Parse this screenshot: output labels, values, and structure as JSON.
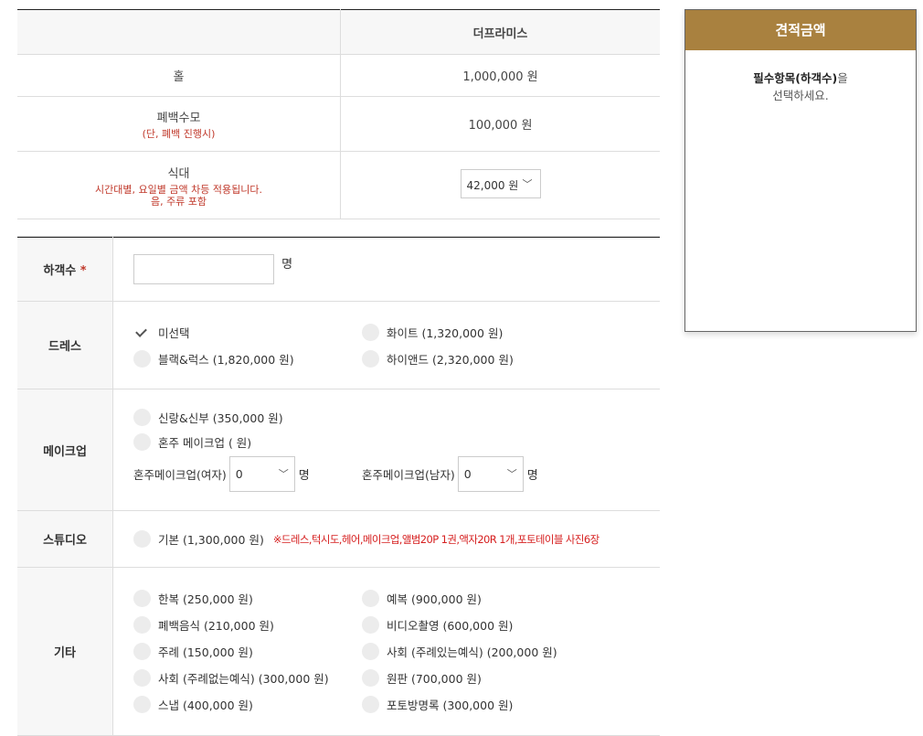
{
  "price_table": {
    "header": "더프라미스",
    "rows": [
      {
        "label": "홀",
        "sub": "",
        "value": "1,000,000 원"
      },
      {
        "label": "폐백수모",
        "sub": "(단, 폐백 진행시)",
        "value": "100,000 원"
      },
      {
        "label": "식대",
        "sub": "시간대별, 요일별 금액 차등 적용됩니다.",
        "sub2": "음, 주류 포함",
        "value": "42,000 원"
      }
    ]
  },
  "guest": {
    "label": "하객수",
    "required_mark": "*",
    "unit": "명",
    "value": ""
  },
  "dress": {
    "label": "드레스",
    "options": [
      "미선택",
      "화이트 (1,320,000 원)",
      "블랙&럭스 (1,820,000 원)",
      "하이앤드 (2,320,000 원)"
    ]
  },
  "makeup": {
    "label": "메이크업",
    "options": [
      "신랑&신부 (350,000 원)",
      "혼주 메이크업 ( 원)"
    ],
    "female_label": "혼주메이크업(여자)",
    "male_label": "혼주메이크업(남자)",
    "female_value": "0",
    "male_value": "0",
    "unit": "명"
  },
  "studio": {
    "label": "스튜디오",
    "option": "기본 (1,300,000 원)",
    "note": "※드레스,턱시도,헤어,메이크업,앨범20P 1권,액자20R 1개,포토테이블 사진6장"
  },
  "etc": {
    "label": "기타",
    "options": [
      "한복 (250,000 원)",
      "예복 (900,000 원)",
      "폐백음식 (210,000 원)",
      "비디오촬영 (600,000 원)",
      "주례 (150,000 원)",
      "사회 (주례있는예식) (200,000 원)",
      "사회 (주례없는예식) (300,000 원)",
      "원판 (700,000 원)",
      "스냅 (400,000 원)",
      "포토방명록 (300,000 원)"
    ]
  },
  "quote": {
    "title": "견적금액",
    "msg_bold": "필수항목(하객수)",
    "msg_rest": "을",
    "msg_line2": "선택하세요."
  },
  "colors": {
    "accent": "#a9813f",
    "required": "#c0392b",
    "note": "#d62020"
  }
}
